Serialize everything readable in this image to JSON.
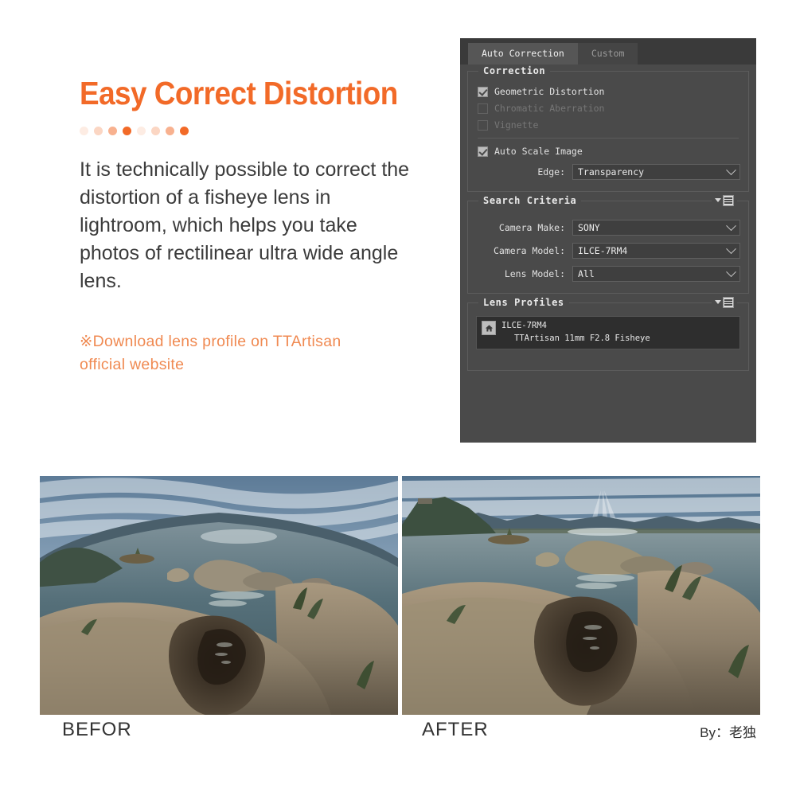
{
  "left": {
    "headline": "Easy Correct Distortion",
    "dots": [
      "o1",
      "o2",
      "o3",
      "o4",
      "o1",
      "o2",
      "o3",
      "o4"
    ],
    "body": "It is technically possible to correct the distortion of a fisheye lens in lightroom, which helps you take photos of rectilinear ultra wide angle lens.",
    "note": "※Download lens profile on TTArtisan official website",
    "accent_color": "#F26A28",
    "note_color": "#F08A52"
  },
  "panel": {
    "tabs": [
      {
        "label": "Auto Correction",
        "active": true
      },
      {
        "label": "Custom",
        "active": false
      }
    ],
    "correction": {
      "legend": "Correction",
      "checkboxes": [
        {
          "label": "Geometric Distortion",
          "checked": true,
          "enabled": true
        },
        {
          "label": "Chromatic Aberration",
          "checked": false,
          "enabled": false
        },
        {
          "label": "Vignette",
          "checked": false,
          "enabled": false
        }
      ],
      "auto_scale": {
        "label": "Auto Scale Image",
        "checked": true
      },
      "edge": {
        "label": "Edge:",
        "value": "Transparency"
      }
    },
    "search_criteria": {
      "legend": "Search Criteria",
      "fields": [
        {
          "label": "Camera Make:",
          "value": "SONY"
        },
        {
          "label": "Camera Model:",
          "value": "ILCE-7RM4"
        },
        {
          "label": "Lens Model:",
          "value": "All"
        }
      ]
    },
    "lens_profiles": {
      "legend": "Lens Profiles",
      "item_title": "ILCE-7RM4",
      "item_subtitle": "TTArtisan 11mm F2.8 Fisheye",
      "icon": "home-icon"
    },
    "icons": {
      "flyout": "flyout-menu-icon",
      "chevron": "chevron-down-icon"
    }
  },
  "comparison": {
    "before_caption": "BEFOR",
    "after_caption": "AFTER",
    "byline": "By：老独"
  }
}
